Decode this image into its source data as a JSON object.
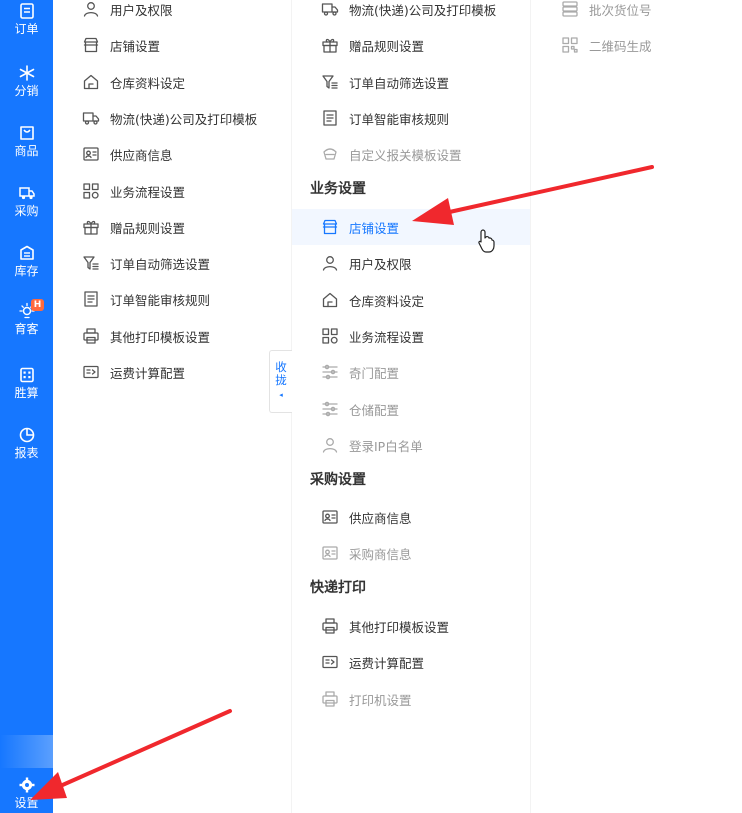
{
  "nav": {
    "items": [
      {
        "label": "订单",
        "icon": "order-list-icon"
      },
      {
        "label": "分销",
        "icon": "distribution-icon"
      },
      {
        "label": "商品",
        "icon": "goods-bag-icon"
      },
      {
        "label": "采购",
        "icon": "purchase-truck-icon"
      },
      {
        "label": "库存",
        "icon": "warehouse-icon"
      },
      {
        "label": "育客",
        "icon": "customer-bulb-icon",
        "badge": "H"
      },
      {
        "label": "胜算",
        "icon": "calculator-icon"
      },
      {
        "label": "报表",
        "icon": "report-pie-icon"
      }
    ],
    "settings": {
      "label": "设置",
      "icon": "gear-icon"
    }
  },
  "column1": {
    "items": [
      {
        "label": "用户及权限",
        "icon": "user-icon"
      },
      {
        "label": "店铺设置",
        "icon": "store-icon"
      },
      {
        "label": "仓库资料设定",
        "icon": "warehouse-house-icon"
      },
      {
        "label": "物流(快递)公司及打印模板",
        "icon": "truck-icon"
      },
      {
        "label": "供应商信息",
        "icon": "supplier-card-icon"
      },
      {
        "label": "业务流程设置",
        "icon": "process-grid-icon"
      },
      {
        "label": "赠品规则设置",
        "icon": "gift-icon"
      },
      {
        "label": "订单自动筛选设置",
        "icon": "filter-icon"
      },
      {
        "label": "订单智能审核规则",
        "icon": "audit-doc-icon"
      },
      {
        "label": "其他打印模板设置",
        "icon": "printer-icon"
      },
      {
        "label": "运费计算配置",
        "icon": "freight-icon"
      }
    ]
  },
  "collapse": {
    "label": "收拢",
    "arrow": "◂"
  },
  "column2": {
    "top_items": [
      {
        "label": "物流(快递)公司及打印模板",
        "icon": "truck-icon"
      },
      {
        "label": "赠品规则设置",
        "icon": "gift-icon"
      },
      {
        "label": "订单自动筛选设置",
        "icon": "filter-icon"
      },
      {
        "label": "订单智能审核规则",
        "icon": "audit-doc-icon"
      },
      {
        "label": "自定义报关模板设置",
        "icon": "customs-icon",
        "dim": true
      }
    ],
    "groups": [
      {
        "title": "业务设置",
        "items": [
          {
            "label": "店铺设置",
            "icon": "store-icon",
            "active": true
          },
          {
            "label": "用户及权限",
            "icon": "user-icon"
          },
          {
            "label": "仓库资料设定",
            "icon": "warehouse-house-icon"
          },
          {
            "label": "业务流程设置",
            "icon": "process-grid-icon"
          },
          {
            "label": "奇门配置",
            "icon": "config-sliders-icon",
            "dim": true
          },
          {
            "label": "仓储配置",
            "icon": "config-sliders-icon",
            "dim": true
          },
          {
            "label": "登录IP白名单",
            "icon": "user-icon",
            "dim": true
          }
        ]
      },
      {
        "title": "采购设置",
        "items": [
          {
            "label": "供应商信息",
            "icon": "supplier-card-icon"
          },
          {
            "label": "采购商信息",
            "icon": "purchaser-card-icon",
            "dim": true
          }
        ]
      },
      {
        "title": "快递打印",
        "items": [
          {
            "label": "其他打印模板设置",
            "icon": "printer-icon"
          },
          {
            "label": "运费计算配置",
            "icon": "freight-icon"
          },
          {
            "label": "打印机设置",
            "icon": "printer-icon",
            "dim": true
          }
        ]
      }
    ]
  },
  "column3": {
    "items": [
      {
        "label": "批次货位号",
        "icon": "batch-stack-icon",
        "dim": true
      },
      {
        "label": "二维码生成",
        "icon": "qrcode-icon",
        "dim": true
      }
    ]
  },
  "colors": {
    "accent": "#1677ff",
    "arrow": "#f0282d",
    "badge": "#ff6a3d"
  }
}
